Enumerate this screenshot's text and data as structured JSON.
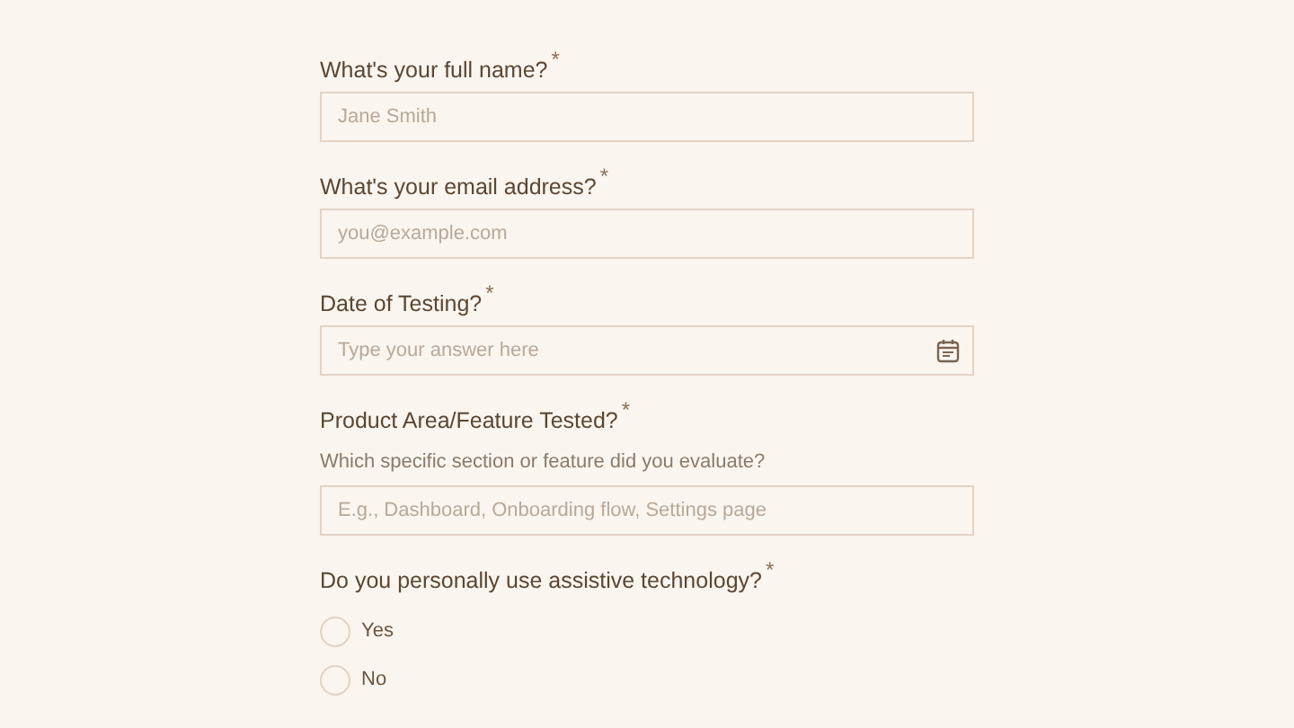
{
  "questions": [
    {
      "kind": "text",
      "label": "What's your full name?",
      "required_mark": "*",
      "placeholder": "Jane Smith"
    },
    {
      "kind": "text",
      "label": "What's your email address?",
      "required_mark": "*",
      "placeholder": "you@example.com"
    },
    {
      "kind": "date",
      "label": "Date of Testing?",
      "required_mark": "*",
      "placeholder": "Type your answer here"
    },
    {
      "kind": "text",
      "label": "Product Area/Feature Tested?",
      "required_mark": "*",
      "description": "Which specific section or feature did you evaluate?",
      "placeholder": "E.g., Dashboard, Onboarding flow, Settings page"
    },
    {
      "kind": "radio",
      "label": "Do you personally use assistive technology?",
      "required_mark": "*",
      "options": [
        {
          "label": "Yes",
          "selected": false
        },
        {
          "label": "No",
          "selected": false
        }
      ]
    }
  ]
}
